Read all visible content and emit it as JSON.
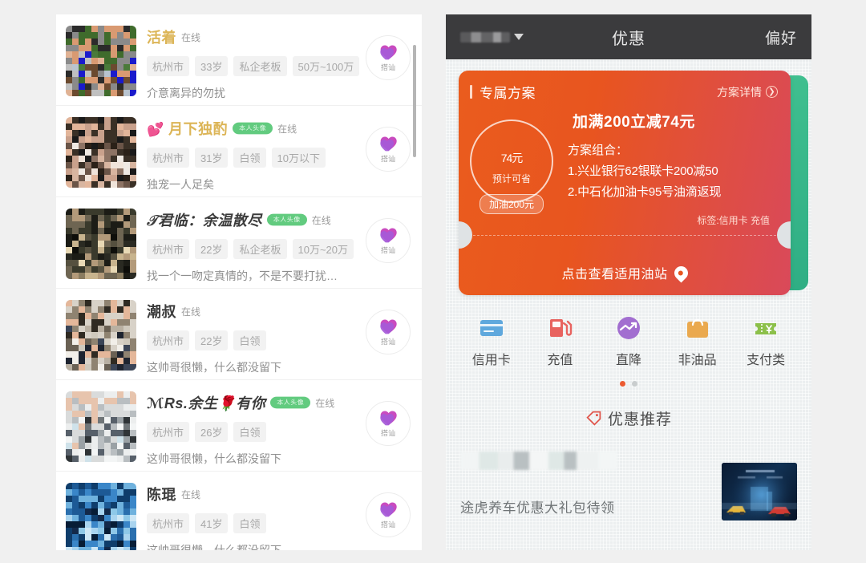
{
  "left_panel": {
    "name": "dating-user-list",
    "scrollbar": true,
    "chat_button_label": "搭讪",
    "users": [
      {
        "name": "活着",
        "name_color": "#dcb557",
        "name_style": "gold",
        "prefix_emoji": "",
        "badge": "",
        "online": "在线",
        "tags": [
          "杭州市",
          "33岁",
          "私企老板",
          "50万~100万"
        ],
        "desc": "介意离异的勿扰",
        "avatar_seed": 11,
        "avatar_palette": [
          "#3f6b2c",
          "#2b2b2b",
          "#d99a72",
          "#8a8a8a",
          "#c0c0c0",
          "#1a1acc",
          "#6b4a2f",
          "#b9c4cf",
          "#4a7a3a",
          "#e0b294"
        ]
      },
      {
        "name": "月下独酌",
        "name_color": "#dcb557",
        "name_style": "gold",
        "prefix_emoji": "💕",
        "badge": "本人头像",
        "online": "在线",
        "tags": [
          "杭州市",
          "31岁",
          "白领",
          "10万以下"
        ],
        "desc": "独宠一人足矣",
        "avatar_seed": 27,
        "avatar_palette": [
          "#1a1a1a",
          "#3a3026",
          "#e2b59a",
          "#c9a18c",
          "#6b5548",
          "#f0e4da",
          "#8d7364",
          "#2b2118",
          "#d8b5a0",
          "#efe9e3"
        ]
      },
      {
        "name": "𝒯君临：余温散尽",
        "name_color": "#3b3b3b",
        "name_style": "dark-italic",
        "prefix_emoji": "",
        "badge": "本人头像",
        "online": "在线",
        "tags": [
          "杭州市",
          "22岁",
          "私企老板",
          "10万~20万"
        ],
        "desc": "找一个一吻定真情的，不是不要打扰…",
        "avatar_seed": 43,
        "avatar_palette": [
          "#1c1c16",
          "#3a3a2c",
          "#6e6552",
          "#b39a7a",
          "#e8d9b5",
          "#2a2a22",
          "#8a7c60",
          "#c8b48e",
          "#55503f",
          "#0e0e0a"
        ]
      },
      {
        "name": "潮叔",
        "name_color": "#3b3b3b",
        "name_style": "dark",
        "prefix_emoji": "",
        "badge": "",
        "online": "在线",
        "tags": [
          "杭州市",
          "22岁",
          "白领"
        ],
        "desc": "这帅哥很懒，什么都没留下",
        "avatar_seed": 61,
        "avatar_palette": [
          "#d8d2c8",
          "#8f8371",
          "#2f2a22",
          "#e4b79a",
          "#b9b0a2",
          "#3b4557",
          "#1e2430",
          "#cfc9bd",
          "#6a6154",
          "#f2efe9"
        ]
      },
      {
        "name": "ℳRs.余生🌹有你",
        "name_color": "#3b3b3b",
        "name_style": "dark-italic",
        "prefix_emoji": "",
        "badge": "本人头像",
        "online": "在线",
        "tags": [
          "杭州市",
          "26岁",
          "白领"
        ],
        "desc": "这帅哥很懒，什么都没留下",
        "avatar_seed": 79,
        "avatar_palette": [
          "#d9dbdb",
          "#eceeee",
          "#b9bec1",
          "#e7c4ad",
          "#6f7578",
          "#2f3437",
          "#9aa1a5",
          "#cfe2ea",
          "#f3f5f5",
          "#57606a"
        ]
      },
      {
        "name": "陈琨",
        "name_color": "#3b3b3b",
        "name_style": "dark",
        "prefix_emoji": "",
        "badge": "",
        "online": "在线",
        "tags": [
          "杭州市",
          "41岁",
          "白领"
        ],
        "desc": "这帅哥很懒，什么都没留下",
        "avatar_seed": 97,
        "avatar_palette": [
          "#0f3d6b",
          "#1d5a96",
          "#3a86c8",
          "#6fb2de",
          "#a9d4ef",
          "#13294a",
          "#2a6fae",
          "#8ec8e8",
          "#cde7f6",
          "#071d36"
        ]
      }
    ]
  },
  "right_panel": {
    "name": "fuel-coupon-app",
    "header": {
      "dropdown_blurred": true,
      "title": "优惠",
      "right_action": "偏好"
    },
    "coupon_card": {
      "label": "专属方案",
      "detail_link": "方案详情",
      "detail_arrow_icon": "chevron-right-icon",
      "save_amount": "74",
      "save_unit": "元",
      "save_caption": "预计可省",
      "fuel_pill": "加油200元",
      "promo_title": "加满200立减74元",
      "combo_label": "方案组合：",
      "combo_items": [
        "1.兴业银行62银联卡200减50",
        "2.中石化加油卡95号油滴返现"
      ],
      "tag_text": "标签:信用卡 充值",
      "bottom_action": "点击查看适用油站",
      "bottom_icon": "location-pin-icon",
      "gradient_from": "#ea5c1e",
      "gradient_to": "#d9495a",
      "back_card_color": "#34b68a"
    },
    "categories": [
      {
        "label": "信用卡",
        "icon": "credit-card-icon",
        "color": "#5fa8dd"
      },
      {
        "label": "充值",
        "icon": "fuel-pump-icon",
        "color": "#e8635f"
      },
      {
        "label": "直降",
        "icon": "price-drop-icon",
        "color": "#a26ed0"
      },
      {
        "label": "非油品",
        "icon": "shopping-bag-icon",
        "color": "#eaa94f"
      },
      {
        "label": "支付类",
        "icon": "voucher-icon",
        "color": "#8cc04a"
      }
    ],
    "pagination": {
      "total": 2,
      "active": 0,
      "active_color": "#ec5b32"
    },
    "recommend": {
      "title": "优惠推荐",
      "title_icon": "price-tag-icon",
      "item_title_blurred": true,
      "item_text": "途虎养车优惠大礼包待领"
    }
  }
}
